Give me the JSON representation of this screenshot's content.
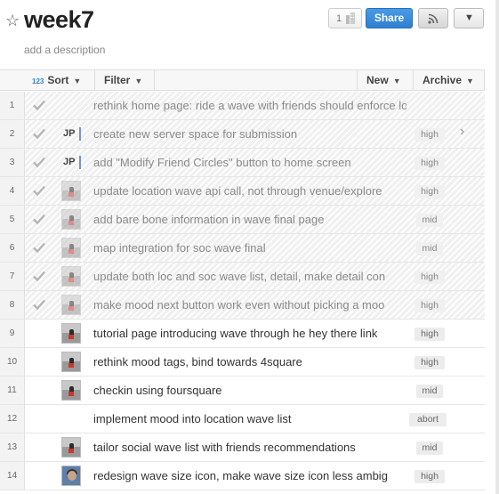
{
  "header": {
    "title": "week7",
    "description": "add a description",
    "follower_count": "1",
    "share_label": "Share"
  },
  "toolbar": {
    "sort_icon": "123",
    "sort_label": "Sort",
    "filter_label": "Filter",
    "new_label": "New",
    "archive_label": "Archive"
  },
  "tasks": [
    {
      "num": "1",
      "text": "rethink home page: ride a wave with friends should enforce logi",
      "tag": "",
      "done": true,
      "assignee": ""
    },
    {
      "num": "2",
      "text": "create new server space for submission",
      "tag": "high",
      "done": true,
      "assignee": "JP"
    },
    {
      "num": "3",
      "text": "add \"Modify Friend Circles\" button to home screen",
      "tag": "high",
      "done": true,
      "assignee": "JP"
    },
    {
      "num": "4",
      "text": "update location wave api call, not through venue/explore",
      "tag": "high",
      "done": true,
      "assignee": "avatar"
    },
    {
      "num": "5",
      "text": "add bare bone information in wave final page",
      "tag": "mid",
      "done": true,
      "assignee": "avatar"
    },
    {
      "num": "6",
      "text": "map integration for soc wave final",
      "tag": "mid",
      "done": true,
      "assignee": "avatar"
    },
    {
      "num": "7",
      "text": "update both loc and soc wave list, detail, make detail con",
      "tag": "high",
      "done": true,
      "assignee": "avatar"
    },
    {
      "num": "8",
      "text": "make mood next button work even without picking a moo",
      "tag": "high",
      "done": true,
      "assignee": "avatar"
    },
    {
      "num": "9",
      "text": "tutorial page introducing wave through he hey there link",
      "tag": "high",
      "done": false,
      "assignee": "avatar"
    },
    {
      "num": "10",
      "text": "rethink mood tags, bind towards 4square",
      "tag": "high",
      "done": false,
      "assignee": "avatar"
    },
    {
      "num": "11",
      "text": "checkin using foursquare",
      "tag": "mid",
      "done": false,
      "assignee": "avatar"
    },
    {
      "num": "12",
      "text": "implement mood into location wave list",
      "tag": "abort",
      "done": false,
      "assignee": ""
    },
    {
      "num": "13",
      "text": "tailor social wave list with friends recommendations",
      "tag": "mid",
      "done": false,
      "assignee": "avatar"
    },
    {
      "num": "14",
      "text": "redesign wave size icon, make wave size icon less ambig",
      "tag": "high",
      "done": false,
      "assignee": "photo"
    }
  ],
  "colors": {
    "share_blue": "#2f7fd0",
    "assignee_bar": "#7b93c9",
    "avatar_red": "#d0342c"
  },
  "icons": {
    "star": "star-icon",
    "check": "checkmark-icon",
    "rss": "rss-icon",
    "dropdown": "chevron-down-icon",
    "expand": "chevron-right-icon",
    "followers": "building-icon"
  }
}
